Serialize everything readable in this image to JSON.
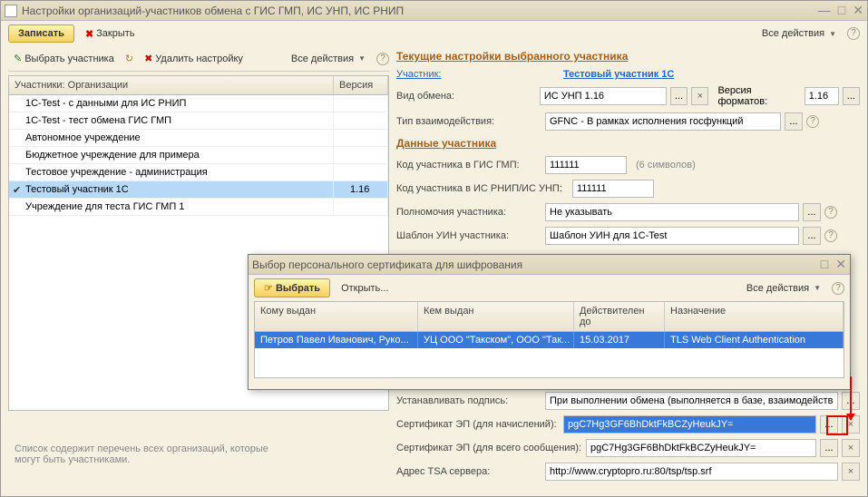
{
  "window": {
    "title": "Настройки организаций-участников обмена с ГИС ГМП, ИС УНП, ИС РНИП"
  },
  "main_toolbar": {
    "save": "Записать",
    "close": "Закрыть",
    "all_actions": "Все действия"
  },
  "left": {
    "toolbar": {
      "select": "Выбрать участника",
      "delete": "Удалить настройку",
      "all_actions": "Все действия"
    },
    "columns": {
      "name": "Участники: Организации",
      "version": "Версия"
    },
    "rows": [
      {
        "name": "1C-Test - с данными для ИС РНИП",
        "version": ""
      },
      {
        "name": "1C-Test - тест обмена ГИС ГМП",
        "version": ""
      },
      {
        "name": "Автономное учреждение",
        "version": ""
      },
      {
        "name": "Бюджетное учреждение для примера",
        "version": ""
      },
      {
        "name": "Тестовое учреждение - администрация",
        "version": ""
      },
      {
        "name": "Тестовый участник 1С",
        "version": "1.16",
        "selected": true
      },
      {
        "name": "Учреждение для теста ГИС ГМП 1",
        "version": ""
      }
    ]
  },
  "right": {
    "section1": "Текущие настройки выбранного участника",
    "participant_label": "Участник:",
    "participant_value": "Тестовый участник 1С",
    "exchange_type_label": "Вид обмена:",
    "exchange_type_value": "ИС УНП 1.16",
    "format_version_label": "Версия форматов:",
    "format_version_value": "1.16",
    "interaction_type_label": "Тип взаимодействия:",
    "interaction_type_value": "GFNC - В рамках исполнения госфункций",
    "section2": "Данные участника",
    "code_gis_label": "Код участника в ГИС ГМП:",
    "code_gis_value": "111111",
    "code_gis_hint": "(6 символов)",
    "code_rnip_label": "Код участника в ИС РНИП/ИС УНП:",
    "code_rnip_value": "111111",
    "auth_label": "Полномочия участника:",
    "auth_value": "Не указывать",
    "uin_label": "Шаблон УИН участника:",
    "uin_value": "Шаблон УИН для 1C-Test",
    "sign_label": "Устанавливать подпись:",
    "sign_value": "При выполнении обмена (выполняется в базе, взаимодейств",
    "cert1_label": "Сертификат ЭП (для начислений):",
    "cert1_value": "pgC7Hg3GF6BhDktFkBCZyHeukJY=",
    "cert2_label": "Сертификат ЭП (для всего сообщения):",
    "cert2_value": "pgC7Hg3GF6BhDktFkBCZyHeukJY=",
    "tsa_label": "Адрес TSA сервера:",
    "tsa_value": "http://www.cryptopro.ru:80/tsp/tsp.srf"
  },
  "footer": "Список содержит перечень всех организаций, которые могут быть участниками.",
  "modal": {
    "title": "Выбор персонального сертификата для шифрования",
    "select": "Выбрать",
    "open": "Открыть...",
    "all_actions": "Все действия",
    "columns": {
      "c1": "Кому выдан",
      "c2": "Кем выдан",
      "c3": "Действителен до",
      "c4": "Назначение"
    },
    "row": {
      "c1": "Петров Павел Иванович, Руко...",
      "c2": "УЦ ООО \"Такском\", ООО \"Так...",
      "c3": "15.03.2017",
      "c4": "TLS Web Client Authentication"
    }
  }
}
